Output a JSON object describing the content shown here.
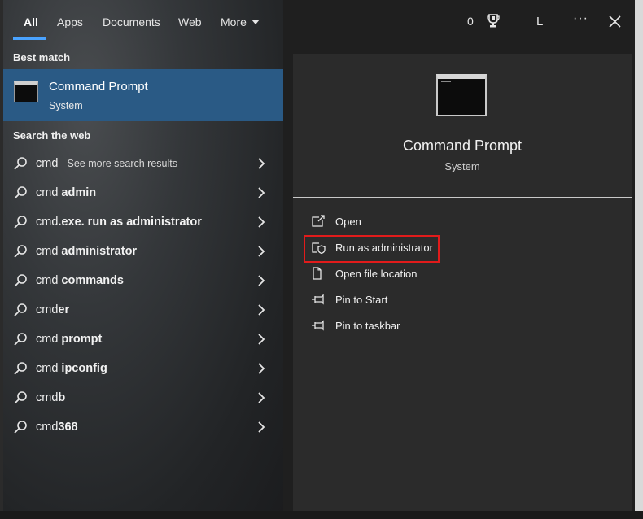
{
  "tabs": [
    {
      "label": "All"
    },
    {
      "label": "Apps"
    },
    {
      "label": "Documents"
    },
    {
      "label": "Web"
    },
    {
      "label": "More"
    }
  ],
  "topbar": {
    "points": "0",
    "trophy_icon": "trophy-icon",
    "avatar_initial": "L",
    "more_label": "···",
    "close_icon": "close-icon"
  },
  "best_match": {
    "heading": "Best match",
    "title": "Command Prompt",
    "subtitle": "System"
  },
  "web": {
    "heading": "Search the web",
    "rows": [
      {
        "prefix": "cmd",
        "bold": "",
        "suffix": " - See more search results"
      },
      {
        "prefix": "cmd ",
        "bold": "admin",
        "suffix": ""
      },
      {
        "prefix": "cmd",
        "bold": ".exe. run as administrator",
        "suffix": ""
      },
      {
        "prefix": "cmd ",
        "bold": "administrator",
        "suffix": ""
      },
      {
        "prefix": "cmd ",
        "bold": "commands",
        "suffix": ""
      },
      {
        "prefix": "cmd",
        "bold": "er",
        "suffix": ""
      },
      {
        "prefix": "cmd ",
        "bold": "prompt",
        "suffix": ""
      },
      {
        "prefix": "cmd ",
        "bold": "ipconfig",
        "suffix": ""
      },
      {
        "prefix": "cmd",
        "bold": "b",
        "suffix": ""
      },
      {
        "prefix": "cmd",
        "bold": "368",
        "suffix": ""
      }
    ]
  },
  "detail": {
    "title": "Command Prompt",
    "subtitle": "System",
    "actions": [
      {
        "label": "Open",
        "icon": "open-icon"
      },
      {
        "label": "Run as administrator",
        "icon": "shield-icon"
      },
      {
        "label": "Open file location",
        "icon": "file-location-icon"
      },
      {
        "label": "Pin to Start",
        "icon": "pin-icon"
      },
      {
        "label": "Pin to taskbar",
        "icon": "pin-icon"
      }
    ]
  },
  "colors": {
    "accent": "#4aa3ff",
    "selection": "#2a5a85",
    "highlight_box": "#e11b1b"
  }
}
